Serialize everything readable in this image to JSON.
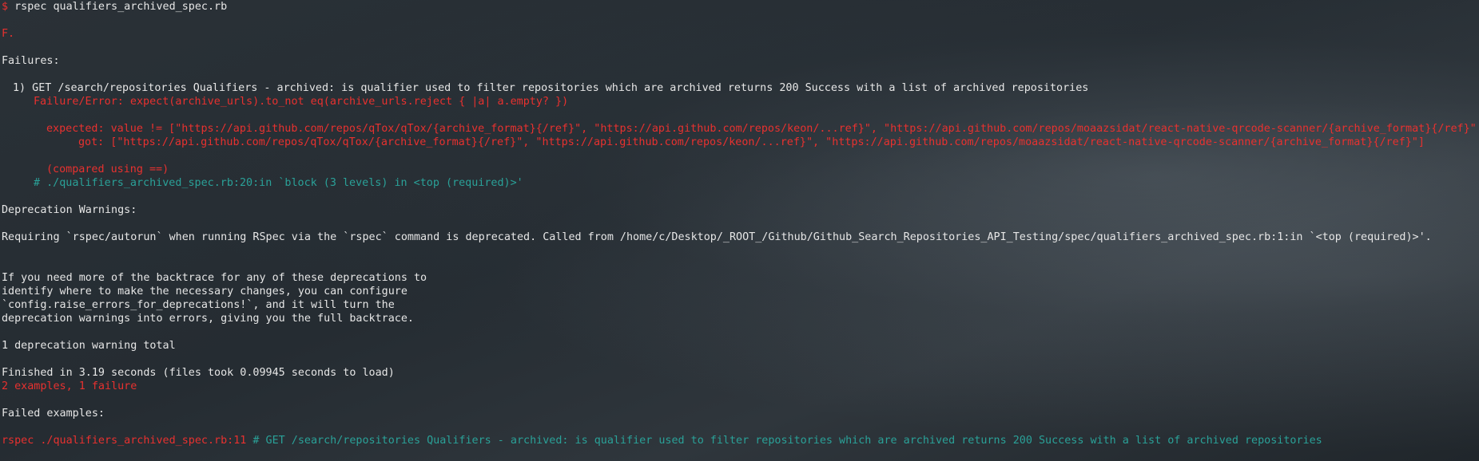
{
  "command": {
    "prompt": "$",
    "text": " rspec qualifiers_archived_spec.rb"
  },
  "progress": "F.",
  "failures_header": "Failures:",
  "failure": {
    "title": "1) GET /search/repositories Qualifiers - archived: is qualifier used to filter repositories which are archived returns 200 Success with a list of archived repositories",
    "error": "Failure/Error: expect(archive_urls).to_not eq(archive_urls.reject { |a| a.empty? })",
    "expected": "expected: value != [\"https://api.github.com/repos/qTox/qTox/{archive_format}{/ref}\", \"https://api.github.com/repos/keon/...ref}\", \"https://api.github.com/repos/moaazsidat/react-native-qrcode-scanner/{archive_format}{/ref}\"]",
    "got": "got: [\"https://api.github.com/repos/qTox/qTox/{archive_format}{/ref}\", \"https://api.github.com/repos/keon/...ref}\", \"https://api.github.com/repos/moaazsidat/react-native-qrcode-scanner/{archive_format}{/ref}\"]",
    "compared": "(compared using ==)",
    "location": "# ./qualifiers_archived_spec.rb:20:in `block (3 levels) in <top (required)>'"
  },
  "deprecation_header": "Deprecation Warnings:",
  "deprecation_message": "Requiring `rspec/autorun` when running RSpec via the `rspec` command is deprecated. Called from /home/c/Desktop/_ROOT_/Github/Github_Search_Repositories_API_Testing/spec/qualifiers_archived_spec.rb:1:in `<top (required)>'.",
  "backtrace_help": [
    "If you need more of the backtrace for any of these deprecations to",
    "identify where to make the necessary changes, you can configure",
    "`config.raise_errors_for_deprecations!`, and it will turn the",
    "deprecation warnings into errors, giving you the full backtrace."
  ],
  "deprecation_total": "1 deprecation warning total",
  "finished": "Finished in 3.19 seconds (files took 0.09945 seconds to load)",
  "summary": "2 examples, 1 failure",
  "failed_examples_header": "Failed examples:",
  "failed_example": {
    "command": "rspec ./qualifiers_archived_spec.rb:11",
    "description": " # GET /search/repositories Qualifiers - archived: is qualifier used to filter repositories which are archived returns 200 Success with a list of archived repositories"
  },
  "colors": {
    "background": "#262d33",
    "text": "#e6e6e6",
    "error": "#e8312f",
    "comment": "#2aa198"
  }
}
